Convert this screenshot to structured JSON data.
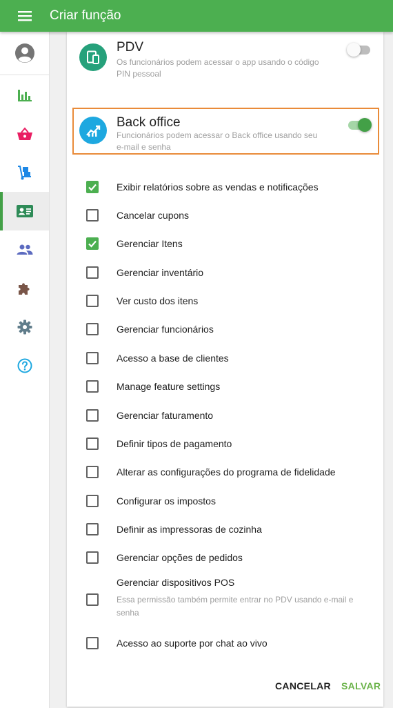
{
  "app": {
    "title": "Criar função"
  },
  "roles": [
    {
      "title": "PDV",
      "description": "Os funcionários podem acessar o app usando o código PIN pessoal",
      "enabled": false,
      "icon": "devices-icon",
      "color": "#26a17b"
    },
    {
      "title": "Back office",
      "description": "Funcionários podem acessar o Back office usando seu e-mail e senha",
      "enabled": true,
      "icon": "trending-up-icon",
      "color": "#1ea8e0"
    }
  ],
  "permissions": [
    {
      "label": "Exibir relatórios sobre as vendas e notificações",
      "checked": true
    },
    {
      "label": "Cancelar cupons",
      "checked": false
    },
    {
      "label": "Gerenciar Itens",
      "checked": true
    },
    {
      "label": "Gerenciar inventário",
      "checked": false
    },
    {
      "label": "Ver custo dos itens",
      "checked": false
    },
    {
      "label": "Gerenciar funcionários",
      "checked": false
    },
    {
      "label": "Acesso a base de clientes",
      "checked": false
    },
    {
      "label": "Manage feature settings",
      "checked": false
    },
    {
      "label": "Gerenciar faturamento",
      "checked": false
    },
    {
      "label": "Definir tipos de pagamento",
      "checked": false
    },
    {
      "label": "Alterar as configurações do programa de fidelidade",
      "checked": false
    },
    {
      "label": "Configurar os impostos",
      "checked": false
    },
    {
      "label": "Definir as impressoras de cozinha",
      "checked": false
    },
    {
      "label": "Gerenciar opções de pedidos",
      "checked": false
    },
    {
      "label": "Gerenciar dispositivos POS",
      "sublabel": "Essa permissão também permite entrar no PDV usando e-mail e senha",
      "checked": false
    },
    {
      "label": "Acesso ao suporte por chat ao vivo",
      "checked": false
    }
  ],
  "actions": {
    "cancel": "CANCELAR",
    "save": "SALVAR"
  },
  "sidebar": {
    "items": [
      {
        "icon": "bar-chart-icon",
        "color": "#4caf50"
      },
      {
        "icon": "basket-icon",
        "color": "#e91e63"
      },
      {
        "icon": "hand-truck-icon",
        "color": "#1e88e5"
      },
      {
        "icon": "badge-icon",
        "color": "#2e8b57",
        "active": true
      },
      {
        "icon": "people-icon",
        "color": "#5c6bc0"
      },
      {
        "icon": "puzzle-icon",
        "color": "#795548"
      },
      {
        "icon": "gear-icon",
        "color": "#607d8b"
      },
      {
        "icon": "help-icon",
        "color": "#1ea8e0"
      }
    ]
  },
  "colors": {
    "accent": "#4caf50",
    "highlight": "#e98b39",
    "save": "#6bb34a"
  }
}
